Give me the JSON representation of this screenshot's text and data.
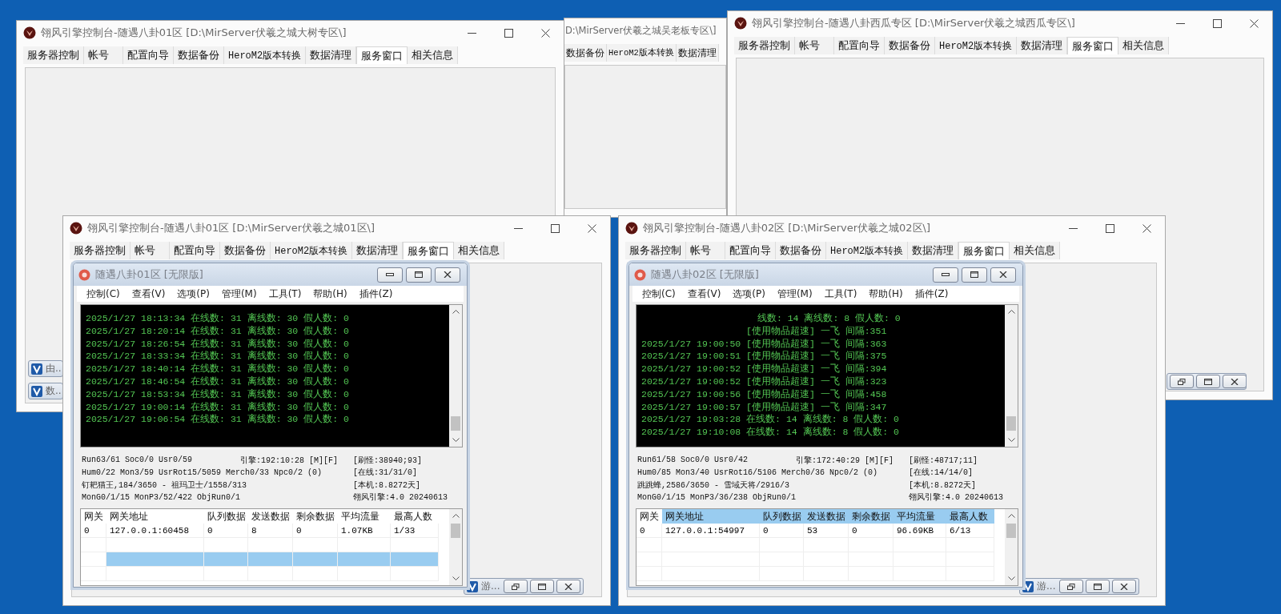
{
  "windows": [
    {
      "kind": "main",
      "title": "翎风引擎控制台-随遇八卦01区 [D:\\MirServer伏羲之城大树专区\\]",
      "tabs": [
        {
          "label": "服务器控制",
          "selected": false
        },
        {
          "label": "帐号",
          "selected": false
        },
        {
          "label": "配置向导",
          "selected": false
        },
        {
          "label": "数据备份",
          "selected": false
        },
        {
          "label": "HeroM2版本转换",
          "selected": false
        },
        {
          "label": "数据清理",
          "selected": false
        },
        {
          "label": "服务窗口",
          "selected": true
        },
        {
          "label": "相关信息",
          "selected": false
        }
      ],
      "minimized": [
        {
          "kind": "label",
          "label": "由..."
        },
        {
          "kind": "label",
          "label": "数..."
        }
      ]
    },
    {
      "kind": "covered",
      "title": "D:\\MirServer伏羲之城吴老板专区\\]",
      "tabs": [
        {
          "label": "数据备份",
          "selected": false
        },
        {
          "label": "HeroM2版本转换",
          "selected": false
        },
        {
          "label": "数据清理",
          "selected": false
        }
      ]
    },
    {
      "kind": "main",
      "title": "翎风引擎控制台-随遇八卦西瓜专区 [D:\\MirServer伏羲之城西瓜专区\\]",
      "tabs": [
        {
          "label": "服务器控制",
          "selected": false
        },
        {
          "label": "帐号",
          "selected": false
        },
        {
          "label": "配置向导",
          "selected": false
        },
        {
          "label": "数据备份",
          "selected": false
        },
        {
          "label": "HeroM2版本转换",
          "selected": false
        },
        {
          "label": "数据清理",
          "selected": false
        },
        {
          "label": "服务窗口",
          "selected": true
        },
        {
          "label": "相关信息",
          "selected": false
        }
      ],
      "minimized": [
        {
          "kind": "buttons"
        }
      ]
    },
    {
      "kind": "main",
      "title": "翎风引擎控制台-随遇八卦01区 [D:\\MirServer伏羲之城01区\\]",
      "tabs": [
        {
          "label": "服务器控制",
          "selected": false
        },
        {
          "label": "帐号",
          "selected": false
        },
        {
          "label": "配置向导",
          "selected": false
        },
        {
          "label": "数据备份",
          "selected": false
        },
        {
          "label": "HeroM2版本转换",
          "selected": false
        },
        {
          "label": "数据清理",
          "selected": false
        },
        {
          "label": "服务窗口",
          "selected": true
        },
        {
          "label": "相关信息",
          "selected": false
        }
      ],
      "minimized": [
        {
          "kind": "full",
          "label": "游..."
        }
      ],
      "child": {
        "title": "随遇八卦01区 [无限版]",
        "menu": [
          "控制(C)",
          "查看(V)",
          "选项(P)",
          "管理(M)",
          "工具(T)",
          "帮助(H)",
          "插件(Z)"
        ],
        "log": [
          {
            "kind": "full",
            "text": "2025/1/27 18:13:34 在线数: 31 离线数: 30 假人数: 0"
          },
          {
            "kind": "full",
            "text": "2025/1/27 18:20:14 在线数: 31 离线数: 30 假人数: 0"
          },
          {
            "kind": "full",
            "text": "2025/1/27 18:26:54 在线数: 31 离线数: 30 假人数: 0"
          },
          {
            "kind": "full",
            "text": "2025/1/27 18:33:34 在线数: 31 离线数: 30 假人数: 0"
          },
          {
            "kind": "full",
            "text": "2025/1/27 18:40:14 在线数: 31 离线数: 30 假人数: 0"
          },
          {
            "kind": "full",
            "text": "2025/1/27 18:46:54 在线数: 31 离线数: 30 假人数: 0"
          },
          {
            "kind": "full",
            "text": "2025/1/27 18:53:34 在线数: 31 离线数: 30 假人数: 0"
          },
          {
            "kind": "full",
            "text": "2025/1/27 19:00:14 在线数: 31 离线数: 30 假人数: 0"
          },
          {
            "kind": "full",
            "text": "2025/1/27 19:06:54 在线数: 31 离线数: 30 假人数: 0"
          }
        ],
        "status": [
          {
            "left": "Run63/61 Soc0/0 Usr0/59",
            "middle": "引擎:192:10:28 [M][F]",
            "right": "[刷怪:38940;93]"
          },
          {
            "left": "Hum0/22 Mon3/59 UsrRot15/5059 Merch0/33 Npc0/2 (0)",
            "right": "[在线:31/31/0]"
          },
          {
            "left": "钉耙猫王,184/3650 - 祖玛卫士/1558/313",
            "right": "[本机:8.8272天]"
          },
          {
            "left": "MonG0/1/15 MonP3/52/422 ObjRun0/1",
            "right": "翎风引擎:4.0 20240613"
          }
        ],
        "table": {
          "columns": [
            {
              "label": "网关",
              "selected": false
            },
            {
              "label": "网关地址",
              "selected": false
            },
            {
              "label": "队列数据",
              "selected": false
            },
            {
              "label": "发送数据",
              "selected": false
            },
            {
              "label": "剩余数据",
              "selected": false
            },
            {
              "label": "平均流量",
              "selected": false
            },
            {
              "label": "最高人数",
              "selected": false
            }
          ],
          "rows": [
            [
              "0",
              "127.0.0.1:60458",
              "0",
              "8",
              "0",
              "1.07KB",
              "1/33"
            ]
          ],
          "blank_rows": [
            {
              "selected": false
            },
            {
              "selected": true
            },
            {
              "selected": false
            }
          ]
        }
      }
    },
    {
      "kind": "main",
      "title": "翎风引擎控制台-随遇八卦02区 [D:\\MirServer伏羲之城02区\\]",
      "tabs": [
        {
          "label": "服务器控制",
          "selected": false
        },
        {
          "label": "帐号",
          "selected": false
        },
        {
          "label": "配置向导",
          "selected": false
        },
        {
          "label": "数据备份",
          "selected": false
        },
        {
          "label": "HeroM2版本转换",
          "selected": false
        },
        {
          "label": "数据清理",
          "selected": false
        },
        {
          "label": "服务窗口",
          "selected": true
        },
        {
          "label": "相关信息",
          "selected": false
        }
      ],
      "minimized": [
        {
          "kind": "full",
          "label": "游..."
        }
      ],
      "child": {
        "title": "随遇八卦02区 [无限版]",
        "menu": [
          "控制(C)",
          "查看(V)",
          "选项(P)",
          "管理(M)",
          "工具(T)",
          "帮助(H)",
          "插件(Z)"
        ],
        "log": [
          {
            "kind": "cut_label",
            "text": "线数: 14 离线数: 8 假人数: 0"
          },
          {
            "kind": "cut_time",
            "text": "[使用物品超速] 一飞 间隔:351"
          },
          {
            "kind": "full",
            "text": "2025/1/27 19:00:50 [使用物品超速] 一飞 间隔:363"
          },
          {
            "kind": "full",
            "text": "2025/1/27 19:00:51 [使用物品超速] 一飞 间隔:375"
          },
          {
            "kind": "full",
            "text": "2025/1/27 19:00:52 [使用物品超速] 一飞 间隔:394"
          },
          {
            "kind": "full",
            "text": "2025/1/27 19:00:52 [使用物品超速] 一飞 间隔:323"
          },
          {
            "kind": "full",
            "text": "2025/1/27 19:00:56 [使用物品超速] 一飞 间隔:458"
          },
          {
            "kind": "full",
            "text": "2025/1/27 19:00:57 [使用物品超速] 一飞 间隔:347"
          },
          {
            "kind": "full",
            "text": "2025/1/27 19:03:28 在线数: 14 离线数: 8 假人数: 0"
          },
          {
            "kind": "full",
            "text": "2025/1/27 19:10:08 在线数: 14 离线数: 8 假人数: 0"
          }
        ],
        "status": [
          {
            "left": "Run61/58 Soc0/0 Usr0/42",
            "middle": "引擎:172:40:29 [M][F]",
            "right": "[刷怪:48717;11]"
          },
          {
            "left": "Hum0/85 Mon3/40 UsrRot16/5106 Merch0/36 Npc0/2 (0)",
            "right": "[在线:14/14/0]"
          },
          {
            "left": "跳跳蜂,2586/3650 - 雪域天将/2916/3",
            "right": "[本机:8.8272天]"
          },
          {
            "left": "MonG0/1/15 MonP3/36/238 ObjRun0/1",
            "right": "翎风引擎:4.0 20240613"
          }
        ],
        "table": {
          "columns": [
            {
              "label": "网关",
              "selected": false
            },
            {
              "label": "网关地址",
              "selected": true
            },
            {
              "label": "队列数据",
              "selected": true
            },
            {
              "label": "发送数据",
              "selected": true
            },
            {
              "label": "剩余数据",
              "selected": true
            },
            {
              "label": "平均流量",
              "selected": true
            },
            {
              "label": "最高人数",
              "selected": true
            }
          ],
          "rows": [
            [
              "0",
              "127.0.0.1:54997",
              "0",
              "53",
              "0",
              "96.69KB",
              "6/13"
            ]
          ],
          "blank_rows": [
            {
              "selected": false
            },
            {
              "selected": false
            },
            {
              "selected": false
            }
          ]
        }
      }
    }
  ]
}
